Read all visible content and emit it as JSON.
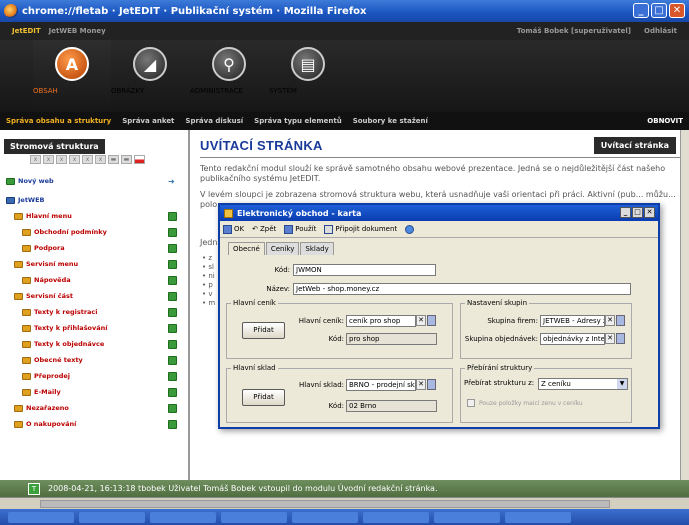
{
  "window": {
    "title": "chrome://fletab · JetEDIT · Publikační systém · Mozilla Firefox"
  },
  "userbar": {
    "product": "JetEDIT",
    "product2": "JetWEB Money",
    "user": "Tomáš Bobek [superuživatel]",
    "logout": "Odhlásit"
  },
  "mainnav": [
    {
      "label": "OBSAH",
      "glyph": "A"
    },
    {
      "label": "OBRÁZKY",
      "glyph": "◢"
    },
    {
      "label": "ADMINISTRACE",
      "glyph": "⚲"
    },
    {
      "label": "SYSTÉM",
      "glyph": "▤"
    }
  ],
  "subnav": {
    "items": [
      "Správa obsahu a struktury",
      "Správa anket",
      "Správa diskusí",
      "Správa typu elementů",
      "Soubory ke stažení"
    ],
    "refresh": "OBNOVIT"
  },
  "sidebar": {
    "title": "Stromová struktura",
    "new_web": "Nový web",
    "tree": [
      {
        "label": "JetWEB"
      },
      {
        "label": "Hlavní menu"
      },
      {
        "label": "Obchodní podmínky"
      },
      {
        "label": "Podpora"
      },
      {
        "label": "Servisní menu"
      },
      {
        "label": "Nápověda"
      },
      {
        "label": "Servisní část"
      },
      {
        "label": "Texty k registraci"
      },
      {
        "label": "Texty k přihlašování"
      },
      {
        "label": "Texty k objednávce"
      },
      {
        "label": "Obecné texty"
      },
      {
        "label": "Přeprodej"
      },
      {
        "label": "E-Maily"
      },
      {
        "label": "Nezařazeno"
      },
      {
        "label": "O nakupování"
      }
    ]
  },
  "main": {
    "title": "UVÍTACÍ STRÁNKA",
    "badge": "Uvítací stránka",
    "para1": "Tento redakční modul slouží ke správě samotného obsahu webové prezentace. Jedná se o nejdůležitější část našeho publikačního systému JetEDIT.",
    "para2": "V levém sloupci je zobrazena stromová struktura webu, která usnadňuje vaši orientaci při práci. Aktivní (pub... můžu... polo...",
    "para3": "Jedn...",
    "bullets": [
      "• z",
      "• sl",
      "• ni",
      "• p",
      "• v",
      "• m"
    ]
  },
  "dialog": {
    "title": "Elektronický obchod - karta",
    "toolbar": {
      "ok": "OK",
      "back": "Zpět",
      "apply": "Použít",
      "attach": "Připojit dokument"
    },
    "tabs": [
      "Obecné",
      "Ceníky",
      "Sklady"
    ],
    "kod_label": "Kód:",
    "kod_value": "JWMON",
    "nazev_label": "Název:",
    "nazev_value": "JetWeb - shop.money.cz",
    "hlavni_cenik": {
      "title": "Hlavní ceník",
      "add": "Přidat",
      "cenik_label": "Hlavní ceník:",
      "cenik_value": "ceník pro shop",
      "kod_label": "Kód:",
      "kod_value": "pro shop"
    },
    "hlavni_sklad": {
      "title": "Hlavní sklad",
      "add": "Přidat",
      "sklad_label": "Hlavní sklad:",
      "sklad_value": "BRNO - prodejní sklad",
      "kod_label": "Kód:",
      "kod_value": "02 Brno"
    },
    "skupiny": {
      "title": "Nastavení skupin",
      "firem_label": "Skupina firem:",
      "firem_value": "JETWEB - Adresy z",
      "obj_label": "Skupina objednávek:",
      "obj_value": "objednávky z Inter"
    },
    "struktura": {
      "title": "Přebírání struktury",
      "label": "Přebírat strukturu z:",
      "value": "Z ceníku",
      "checkbox": "Pouze položky maicí zenu v ceníku"
    }
  },
  "status": {
    "text": "2008-04-21, 16:13:18 tbobek Uživatel Tomáš Bobek vstoupil do modulu Úvodní redakční stránka."
  }
}
